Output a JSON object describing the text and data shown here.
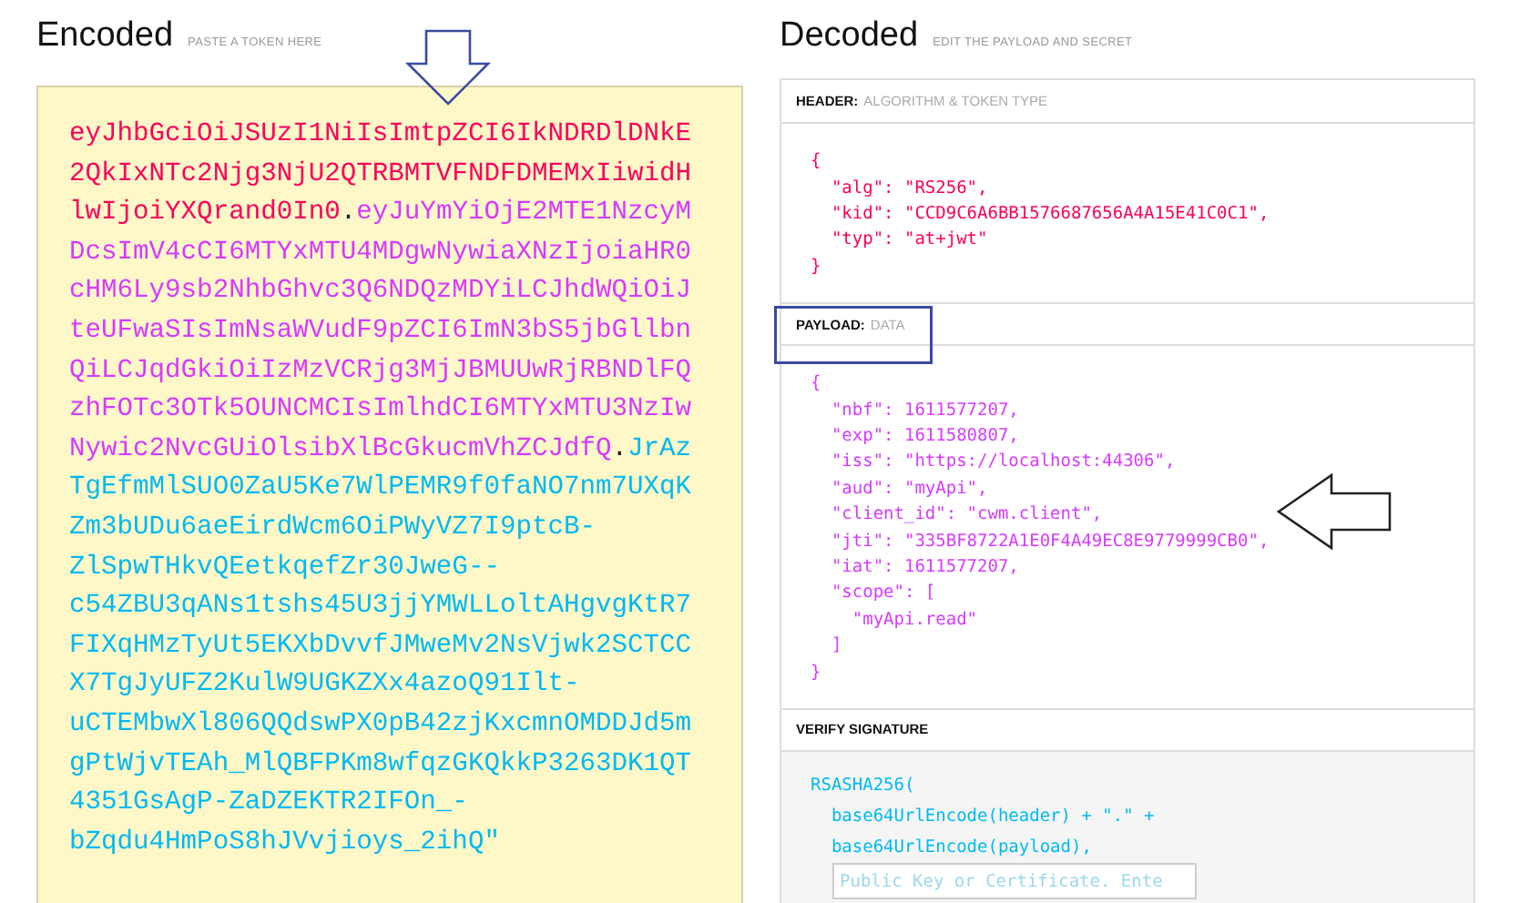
{
  "encoded": {
    "title": "Encoded",
    "subtitle": "PASTE A TOKEN HERE",
    "token_lines": [
      [
        {
          "kind": "header",
          "text": "eyJhbGciOiJSUzI1NiIsImtpZCI6IkNDRDlDNkE"
        }
      ],
      [
        {
          "kind": "header",
          "text": "2QkIxNTc2Njg3NjU2QTRBMTVFNDFDMEMxIiwidH"
        }
      ],
      [
        {
          "kind": "header",
          "text": "lwIjoiYXQrand0In0"
        },
        {
          "kind": "dot",
          "text": "."
        },
        {
          "kind": "payload",
          "text": "eyJuYmYiOjE2MTE1NzcyM"
        }
      ],
      [
        {
          "kind": "payload",
          "text": "DcsImV4cCI6MTYxMTU4MDgwNywiaXNzIjoiaHR0"
        }
      ],
      [
        {
          "kind": "payload",
          "text": "cHM6Ly9sb2NhbGhvc3Q6NDQzMDYiLCJhdWQiOiJ"
        }
      ],
      [
        {
          "kind": "payload",
          "text": "teUFwaSIsImNsaWVudF9pZCI6ImN3bS5jbGllbn"
        }
      ],
      [
        {
          "kind": "payload",
          "text": "QiLCJqdGkiOiIzMzVCRjg3MjJBMUUwRjRBNDlFQ"
        }
      ],
      [
        {
          "kind": "payload",
          "text": "zhFOTc3OTk5OUNCMCIsImlhdCI6MTYxMTU3NzIw"
        }
      ],
      [
        {
          "kind": "payload",
          "text": "Nywic2NvcGUiOlsibXlBcGkucmVhZCJdfQ"
        },
        {
          "kind": "dot",
          "text": "."
        },
        {
          "kind": "signature",
          "text": "JrAz"
        }
      ],
      [
        {
          "kind": "signature",
          "text": "TgEfmMlSUO0ZaU5Ke7WlPEMR9f0faNO7nm7UXqK"
        }
      ],
      [
        {
          "kind": "signature",
          "text": "Zm3bUDu6aeEirdWcm6OiPWyVZ7I9ptcB-"
        }
      ],
      [
        {
          "kind": "signature",
          "text": "ZlSpwTHkvQEetkqefZr30JweG--"
        }
      ],
      [
        {
          "kind": "signature",
          "text": "c54ZBU3qANs1tshs45U3jjYMWLLoltAHgvgKtR7"
        }
      ],
      [
        {
          "kind": "signature",
          "text": "FIXqHMzTyUt5EKXbDvvfJMweMv2NsVjwk2SCTCC"
        }
      ],
      [
        {
          "kind": "signature",
          "text": "X7TgJyUFZ2KulW9UGKZXx4azoQ91Ilt-"
        }
      ],
      [
        {
          "kind": "signature",
          "text": "uCTEMbwXl806QQdswPX0pB42zjKxcmnOMDDJd5m"
        }
      ],
      [
        {
          "kind": "signature",
          "text": "gPtWjvTEAh_MlQBFPKm8wfqzGKQkkP3263DK1QT"
        }
      ],
      [
        {
          "kind": "signature",
          "text": "4351GsAgP-ZaDZEKTR2IFOn_-"
        }
      ],
      [
        {
          "kind": "signature",
          "text": "bZqdu4HmPoS8hJVvjioys_2ihQ\""
        }
      ]
    ]
  },
  "decoded": {
    "title": "Decoded",
    "subtitle": "EDIT THE PAYLOAD AND SECRET",
    "sections": [
      {
        "kind": "header",
        "label": "HEADER:",
        "caption": "ALGORITHM & TOKEN TYPE",
        "lines": [
          "{",
          "  \"alg\": \"RS256\",",
          "  \"kid\": \"CCD9C6A6BB1576687656A4A15E41C0C1\",",
          "  \"typ\": \"at+jwt\"",
          "}"
        ]
      },
      {
        "kind": "payload",
        "label": "PAYLOAD:",
        "caption": "DATA",
        "lines": [
          "{",
          "  \"nbf\": 1611577207,",
          "  \"exp\": 1611580807,",
          "  \"iss\": \"https://localhost:44306\",",
          "  \"aud\": \"myApi\",",
          "  \"client_id\": \"cwm.client\",",
          "  \"jti\": \"335BF8722A1E0F4A49EC8E9779999CB0\",",
          "  \"iat\": 1611577207,",
          "  \"scope\": [",
          "    \"myApi.read\"",
          "  ]",
          "}"
        ]
      },
      {
        "kind": "signature",
        "label": "VERIFY SIGNATURE",
        "lines": [
          "RSASHA256(",
          "  base64UrlEncode(header) + \".\" +",
          "  base64UrlEncode(payload),"
        ],
        "placeholder": "Public Key or Certificate. Ente"
      }
    ]
  }
}
